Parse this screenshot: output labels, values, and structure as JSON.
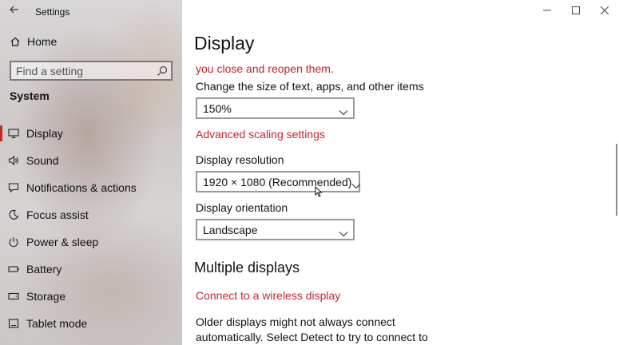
{
  "window": {
    "title": "Settings",
    "controls": {
      "minimize": "minimize",
      "maximize": "maximize",
      "close": "close"
    }
  },
  "sidebar": {
    "home_label": "Home",
    "search": {
      "placeholder": "Find a setting"
    },
    "section_title": "System",
    "items": [
      {
        "label": "Display",
        "icon": "monitor-icon",
        "active": true
      },
      {
        "label": "Sound",
        "icon": "speaker-icon"
      },
      {
        "label": "Notifications & actions",
        "icon": "message-icon"
      },
      {
        "label": "Focus assist",
        "icon": "moon-icon"
      },
      {
        "label": "Power & sleep",
        "icon": "power-icon"
      },
      {
        "label": "Battery",
        "icon": "battery-icon"
      },
      {
        "label": "Storage",
        "icon": "storage-icon"
      },
      {
        "label": "Tablet mode",
        "icon": "tablet-icon"
      }
    ]
  },
  "main": {
    "title": "Display",
    "warning": "you close and reopen them.",
    "scale": {
      "label": "Change the size of text, apps, and other items",
      "value": "150%",
      "advanced_link": "Advanced scaling settings"
    },
    "resolution": {
      "label": "Display resolution",
      "value": "1920 × 1080 (Recommended)"
    },
    "orientation": {
      "label": "Display orientation",
      "value": "Landscape"
    },
    "multiple": {
      "heading": "Multiple displays",
      "wireless_link": "Connect to a wireless display",
      "description": "Older displays might not always connect automatically. Select Detect to try to connect to"
    }
  },
  "colors": {
    "accent": "#c42b1c",
    "link": "#c4262b"
  }
}
